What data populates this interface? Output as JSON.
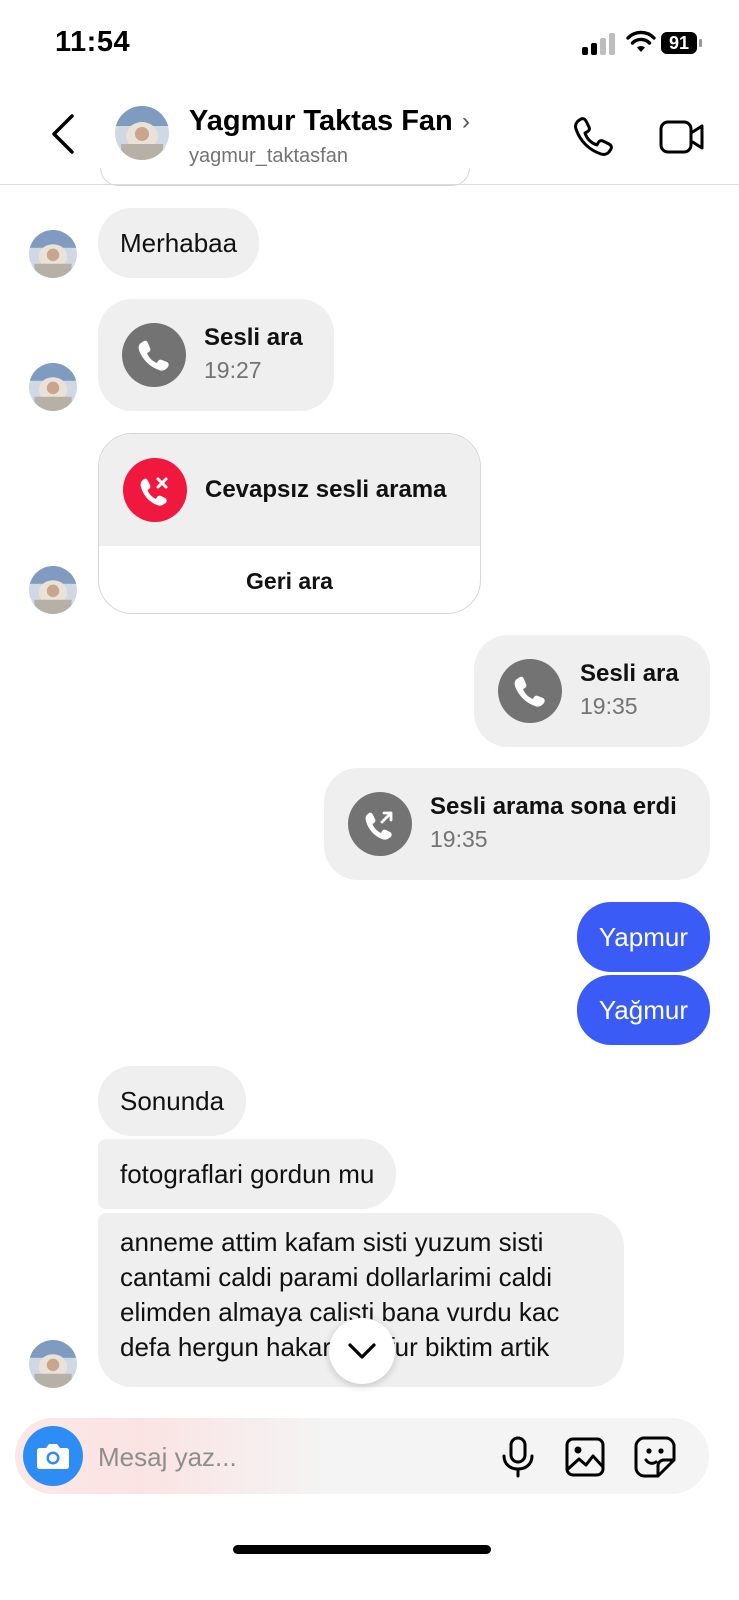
{
  "status_bar": {
    "time": "11:54",
    "battery": "91"
  },
  "header": {
    "name": "Yagmur Taktas Fan",
    "username": "yagmur_taktasfan",
    "chevron": "›",
    "icons": {
      "back": "chevron-left-icon",
      "call": "phone-icon",
      "video": "video-camera-icon"
    }
  },
  "messages": [
    {
      "from": "them",
      "type": "text",
      "text": "Merhabaa"
    },
    {
      "from": "them",
      "type": "call",
      "title": "Sesli ara",
      "time": "19:27"
    },
    {
      "from": "them",
      "type": "missed_call",
      "title": "Cevapsız sesli arama",
      "action": "Geri ara"
    },
    {
      "from": "me",
      "type": "call",
      "title": "Sesli ara",
      "time": "19:35"
    },
    {
      "from": "me",
      "type": "call_ended",
      "title": "Sesli arama sona erdi",
      "time": "19:35"
    },
    {
      "from": "me",
      "type": "text",
      "text": "Yapmur"
    },
    {
      "from": "me",
      "type": "text",
      "text": "Yağmur"
    },
    {
      "from": "them",
      "type": "text",
      "text": "Sonunda"
    },
    {
      "from": "them",
      "type": "text",
      "text": "fotograflari gordun mu"
    },
    {
      "from": "them",
      "type": "text",
      "text": "anneme attim kafam sisti yuzum sisti cantami caldi parami dollarlarimi caldi elimden almaya calisti bana vurdu kac defa hergun hakaret kufur biktim artik"
    }
  ],
  "composer": {
    "placeholder": "Mesaj yaz..."
  },
  "colors": {
    "sent_bubble": "#3b5bf6",
    "received_bubble": "#efefef",
    "missed_call": "#f0183f",
    "camera_button": "#2e8df5"
  }
}
